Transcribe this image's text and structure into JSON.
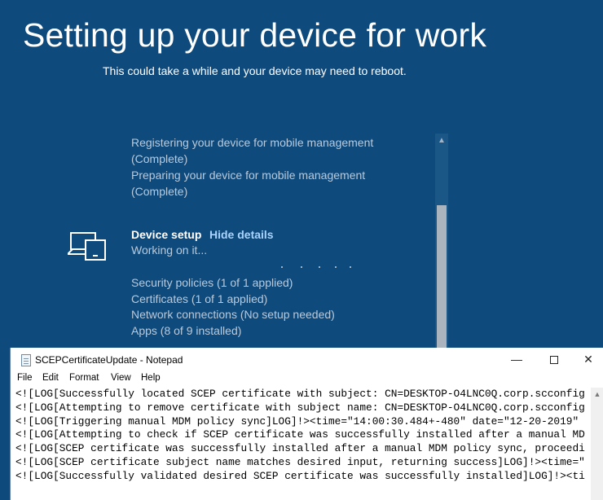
{
  "oobe": {
    "title": "Setting up your device for work",
    "subtitle": "This could take a while and your device may need to reboot.",
    "completed_steps": [
      "Registering your device for mobile management",
      "(Complete)",
      "Preparing your device for mobile management",
      "(Complete)"
    ],
    "device_setup": {
      "title": "Device setup",
      "hide_details": "Hide details",
      "status": "Working on it...",
      "details": [
        "Security policies (1 of 1 applied)",
        "Certificates (1 of 1 applied)",
        "Network connections (No setup needed)",
        "Apps (8 of 9 installed)"
      ]
    },
    "icons": {
      "device": "laptop-device-icon",
      "scroll_up": "chevron-up-icon"
    },
    "colors": {
      "background": "#0f4a7c",
      "link": "#a8d4ff",
      "muted_text": "#b9cadb"
    }
  },
  "notepad": {
    "title": "SCEPCertificateUpdate - Notepad",
    "buttons": {
      "minimize": "—",
      "close": "✕"
    },
    "menu": [
      "File",
      "Edit",
      "Format",
      "View",
      "Help"
    ],
    "lines": [
      "<![LOG[Successfully located SCEP certificate with subject: CN=DESKTOP-O4LNC0Q.corp.scconfig",
      "<![LOG[Attempting to remove certificate with subject name: CN=DESKTOP-O4LNC0Q.corp.scconfig",
      "<![LOG[Triggering manual MDM policy sync]LOG]!><time=\"14:00:30.484+-480\" date=\"12-20-2019\"",
      "<![LOG[Attempting to check if SCEP certificate was successfully installed after a manual MD",
      "<![LOG[SCEP certificate was successfully installed after a manual MDM policy sync, proceedi",
      "<![LOG[SCEP certificate subject name matches desired input, returning success]LOG]!><time=\"",
      "<![LOG[Successfully validated desired SCEP certificate was successfully installed]LOG]!><ti"
    ]
  }
}
